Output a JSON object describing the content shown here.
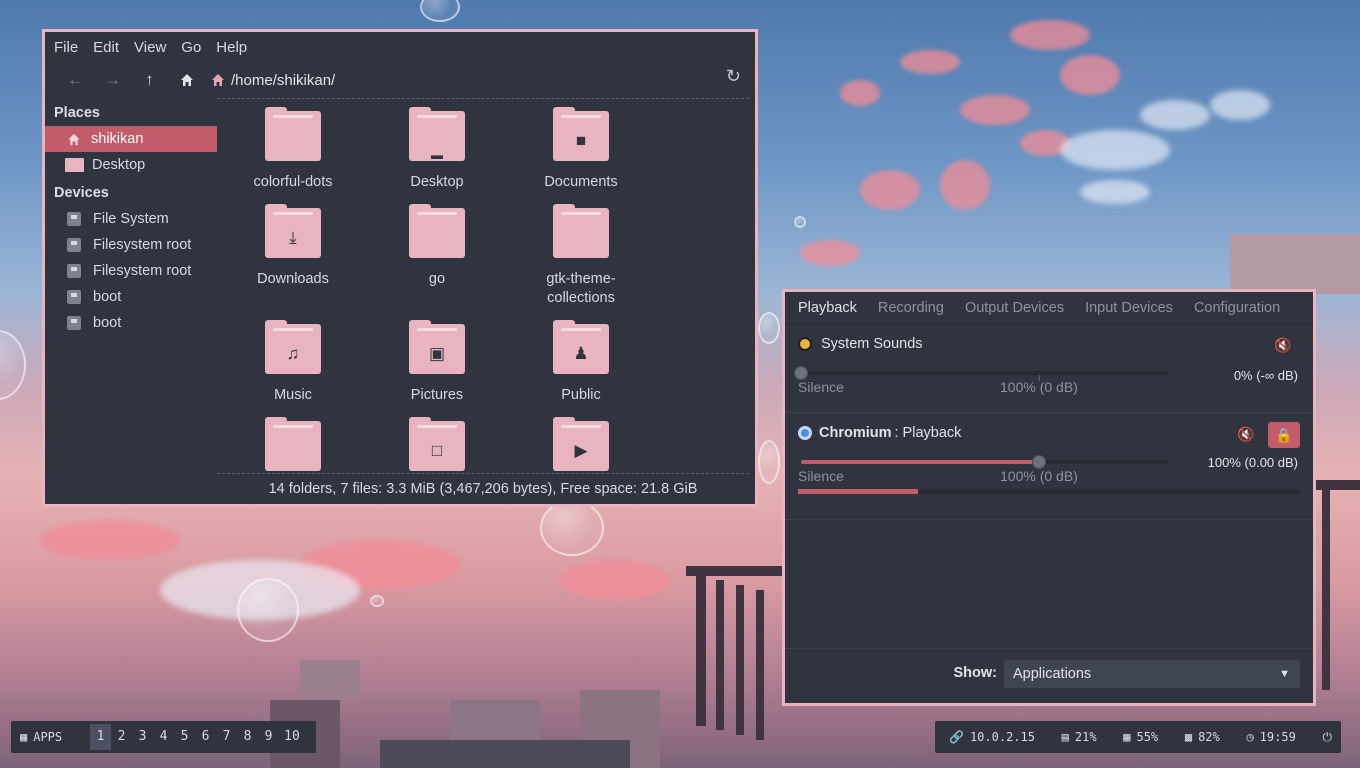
{
  "file_manager": {
    "menu": [
      "File",
      "Edit",
      "View",
      "Go",
      "Help"
    ],
    "path": "/home/shikikan/",
    "sidebar": {
      "places_title": "Places",
      "places": [
        {
          "label": "shikikan",
          "icon": "home-icon",
          "selected": true
        },
        {
          "label": "Desktop",
          "icon": "desktop-icon",
          "selected": false
        }
      ],
      "devices_title": "Devices",
      "devices": [
        {
          "label": "File System",
          "icon": "harddisk-icon"
        },
        {
          "label": "Filesystem root",
          "icon": "eject-icon"
        },
        {
          "label": "Filesystem root",
          "icon": "eject-icon"
        },
        {
          "label": "boot",
          "icon": "eject-icon"
        },
        {
          "label": "boot",
          "icon": "eject-icon"
        }
      ]
    },
    "files": [
      {
        "name": "colorful-dots",
        "icon": "folder-icon"
      },
      {
        "name": "Desktop",
        "icon": "desktop-folder-icon"
      },
      {
        "name": "Documents",
        "icon": "documents-folder-icon"
      },
      {
        "name": "Downloads",
        "icon": "downloads-folder-icon"
      },
      {
        "name": "go",
        "icon": "folder-icon"
      },
      {
        "name": "gtk-theme-collections",
        "icon": "folder-icon"
      },
      {
        "name": "Music",
        "icon": "music-folder-icon"
      },
      {
        "name": "Pictures",
        "icon": "pictures-folder-icon"
      },
      {
        "name": "Public",
        "icon": "public-folder-icon"
      },
      {
        "name": "",
        "icon": "folder-icon"
      },
      {
        "name": "",
        "icon": "templates-folder-icon"
      },
      {
        "name": "",
        "icon": "videos-folder-icon"
      }
    ],
    "status": "14 folders, 7 files: 3.3 MiB (3,467,206 bytes), Free space: 21.8 GiB"
  },
  "mixer": {
    "tabs": [
      "Playback",
      "Recording",
      "Output Devices",
      "Input Devices",
      "Configuration"
    ],
    "active_tab": "Playback",
    "streams": [
      {
        "app": "System Sounds",
        "name": "",
        "volume_text": "0% (-∞ dB)",
        "volume": 0.0,
        "level": 0.0,
        "silence": "Silence",
        "hundred": "100% (0 dB)"
      },
      {
        "app": "Chromium",
        "name": ": Playback",
        "volume_text": "100% (0.00 dB)",
        "volume": 1.0,
        "level": 0.24,
        "silence": "Silence",
        "hundred": "100% (0 dB)"
      }
    ],
    "show_label": "Show:",
    "show_value": "Applications"
  },
  "taskbar": {
    "apps_label": "APPS",
    "workspaces": [
      "1",
      "2",
      "3",
      "4",
      "5",
      "6",
      "7",
      "8",
      "9",
      "10"
    ],
    "active_workspace": "1",
    "ip": "10.0.2.15",
    "disk": "21%",
    "cpu": "55%",
    "mem": "82%",
    "time": "19:59"
  },
  "colors": {
    "accent": "#c25c68",
    "folder": "#e8b4c0",
    "panel": "#2f343f"
  }
}
